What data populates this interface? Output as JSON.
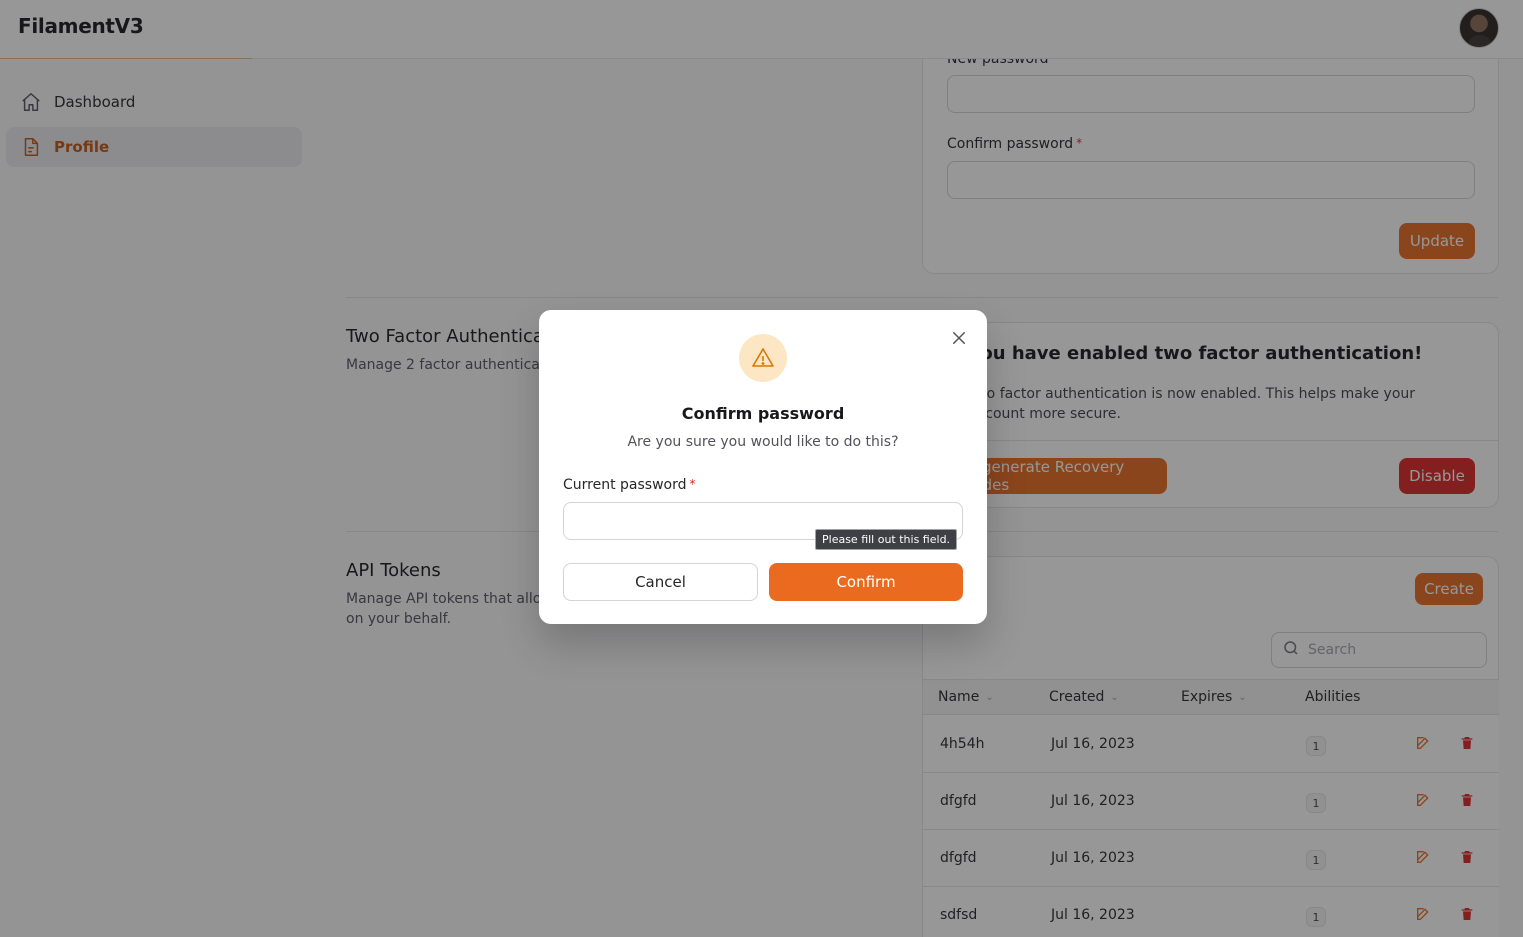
{
  "app": {
    "brand": "FilamentV3"
  },
  "sidebar": {
    "items": [
      {
        "label": "Dashboard",
        "icon": "home-icon",
        "active": false
      },
      {
        "label": "Profile",
        "icon": "document-icon",
        "active": true
      }
    ]
  },
  "password_section": {
    "new_password_label": "New password",
    "confirm_password_label": "Confirm password",
    "required_mark": "*",
    "update_label": "Update"
  },
  "two_factor": {
    "title": "Two Factor Authentication",
    "description": "Manage 2 factor authentication",
    "enabled_title": "You have enabled two factor authentication!",
    "enabled_text": "Two factor authentication is now enabled. This helps make your account more secure.",
    "recovery_label": "Regenerate Recovery Codes",
    "disable_label": "Disable"
  },
  "api_tokens": {
    "title": "API Tokens",
    "description": "Manage API tokens that allow third-party services to access this application on your behalf.",
    "create_label": "Create",
    "search_placeholder": "Search",
    "columns": [
      "Name",
      "Created",
      "Expires",
      "Abilities"
    ],
    "rows": [
      {
        "name": "4h54h",
        "created": "Jul 16, 2023",
        "expires": "",
        "abilities": "1"
      },
      {
        "name": "dfgfd",
        "created": "Jul 16, 2023",
        "expires": "",
        "abilities": "1"
      },
      {
        "name": "dfgfd",
        "created": "Jul 16, 2023",
        "expires": "",
        "abilities": "1"
      },
      {
        "name": "sdfsd",
        "created": "Jul 16, 2023",
        "expires": "",
        "abilities": "1"
      }
    ]
  },
  "modal": {
    "title": "Confirm password",
    "subtitle": "Are you sure you would like to do this?",
    "field_label": "Current password",
    "required_mark": "*",
    "validation_tooltip": "Please fill out this field.",
    "cancel_label": "Cancel",
    "confirm_label": "Confirm"
  },
  "colors": {
    "primary": "#ea6b1f",
    "danger": "#dc2626",
    "warning_bg": "#fde6c4",
    "warning_icon": "#d97706"
  }
}
